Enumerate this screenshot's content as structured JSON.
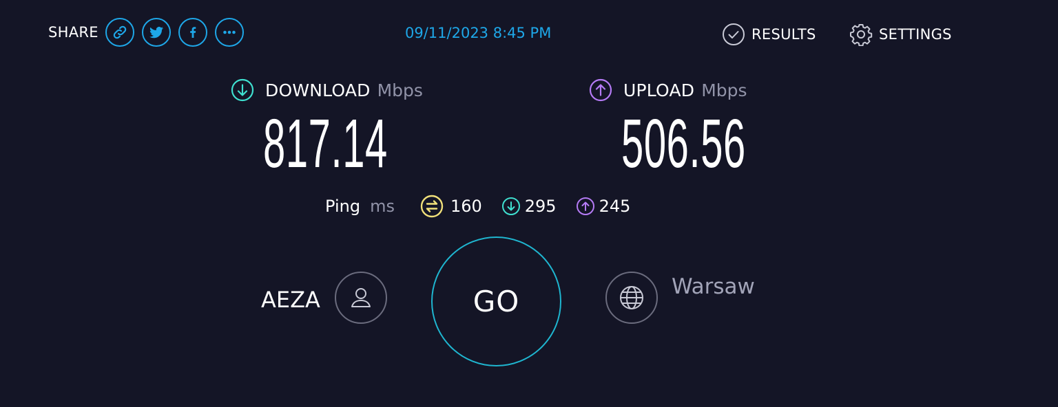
{
  "header": {
    "share_label": "SHARE",
    "share_buttons": [
      {
        "icon": "link-icon"
      },
      {
        "icon": "twitter-icon"
      },
      {
        "icon": "facebook-icon"
      },
      {
        "icon": "more-icon"
      }
    ],
    "datetime": "09/11/2023 8:45 PM",
    "results_label": "RESULTS",
    "settings_label": "SETTINGS"
  },
  "download": {
    "label": "DOWNLOAD",
    "unit": "Mbps",
    "value": "817.14",
    "icon": "download-arrow-icon",
    "color": "#3fe0d0"
  },
  "upload": {
    "label": "UPLOAD",
    "unit": "Mbps",
    "value": "506.56",
    "icon": "upload-arrow-icon",
    "color": "#b57bf5"
  },
  "ping": {
    "label": "Ping",
    "unit": "ms",
    "idle": "160",
    "download": "295",
    "upload": "245",
    "idle_color": "#f1e07a"
  },
  "connection": {
    "isp": "AEZA",
    "server": "Warsaw",
    "go_label": "GO"
  },
  "colors": {
    "background": "#141526",
    "accent_blue": "#1ea7e8",
    "go_ring": "#1fb6d0",
    "muted_text": "#9193a8"
  }
}
